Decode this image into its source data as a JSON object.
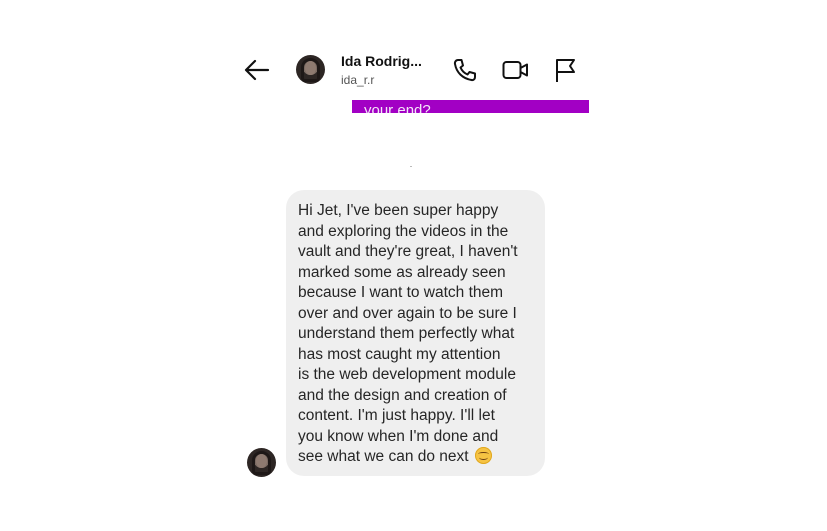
{
  "header": {
    "contact_name": "Ida Rodrig...",
    "contact_handle": "ida_r.r",
    "back_icon": "arrow-left-icon",
    "call_icon": "phone-icon",
    "video_icon": "video-camera-icon",
    "flag_icon": "flag-icon"
  },
  "previous_message": {
    "text_fragment": "your end?",
    "color": "#a200c4"
  },
  "incoming_message": {
    "text": "Hi Jet, I've been super happy\nand exploring the videos in the\nvault and they're great, I haven't\nmarked some as already seen\nbecause I want to watch them\nover and over again to be sure I\nunderstand them perfectly what\nhas most caught my attention\nis the web development module\nand the design and creation of\ncontent. I'm just happy. I'll let\nyou know when I'm done and\nsee what we can do next",
    "emoji": "smiling-face-emoji",
    "bubble_color": "#efefef"
  }
}
